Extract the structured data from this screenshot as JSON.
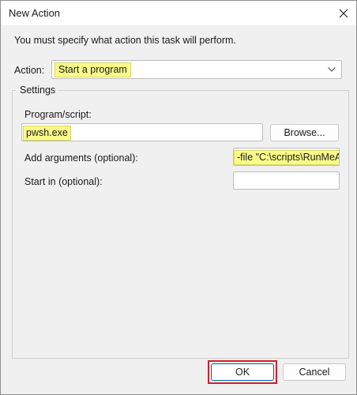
{
  "window": {
    "title": "New Action",
    "close_glyph": "✕"
  },
  "instruction": "You must specify what action this task will perform.",
  "action": {
    "label": "Action:",
    "selected": "Start a program",
    "dropdown_icon": "chevron-down-icon"
  },
  "settings": {
    "legend": "Settings",
    "program_label": "Program/script:",
    "program_value": "pwsh.exe",
    "browse_label": "Browse...",
    "arguments_label": "Add arguments (optional):",
    "arguments_value": "-file \"C:\\scripts\\RunMeA",
    "start_in_label": "Start in (optional):",
    "start_in_value": ""
  },
  "buttons": {
    "ok": "OK",
    "cancel": "Cancel"
  },
  "colors": {
    "highlight": "#fbfb8a",
    "ok_outline": "#d0202a",
    "default_button_border": "#005fb8"
  }
}
